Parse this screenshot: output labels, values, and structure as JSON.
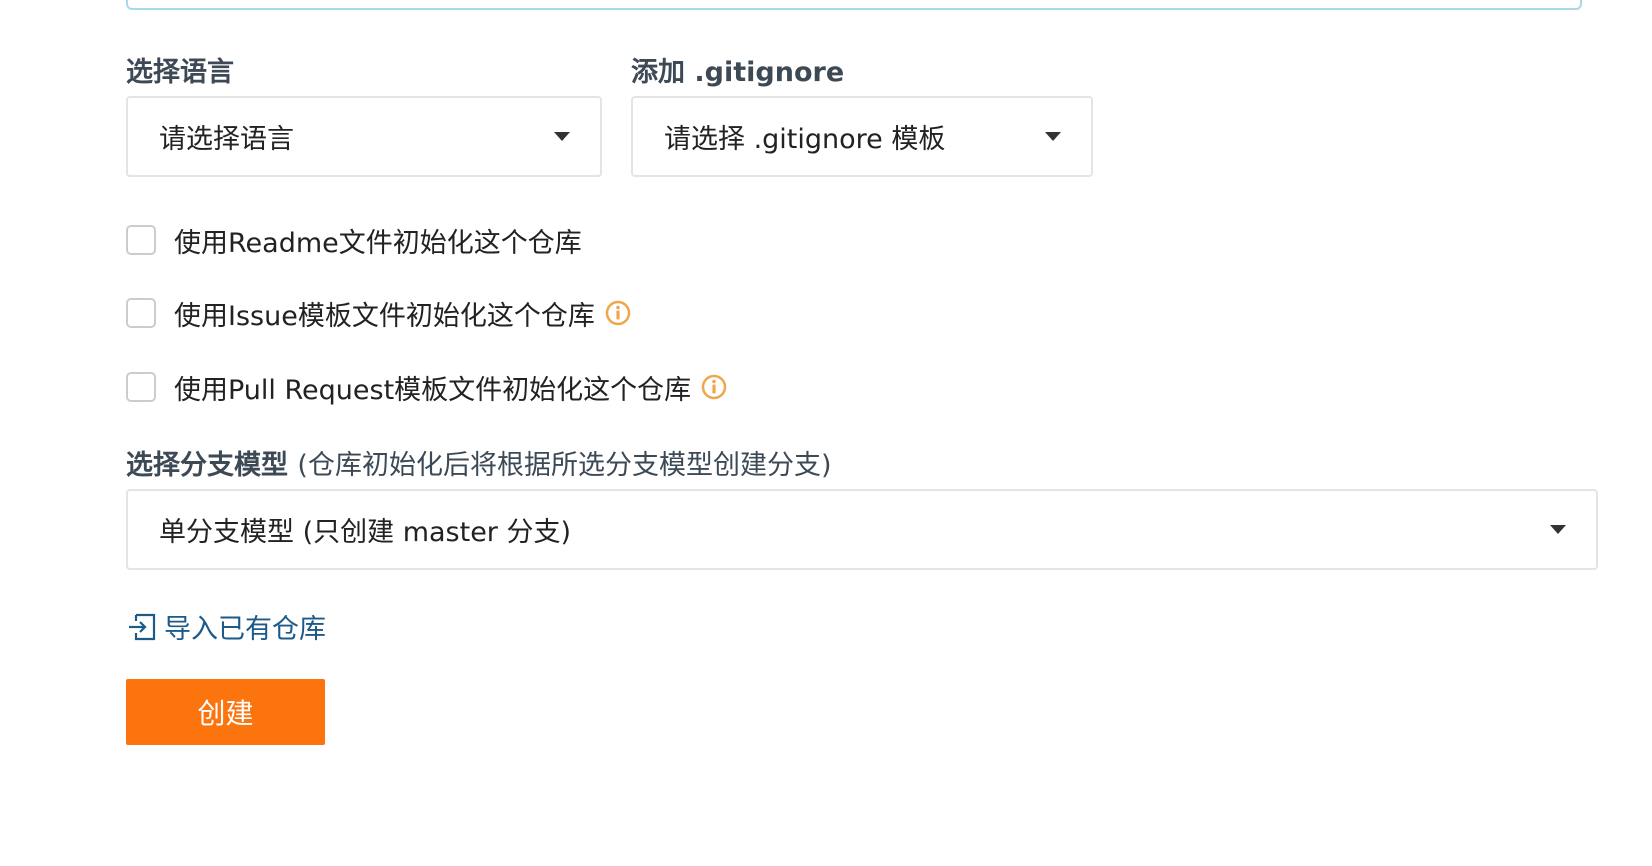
{
  "language": {
    "label": "选择语言",
    "selected": "请选择语言"
  },
  "gitignore": {
    "label": "添加 .gitignore",
    "selected": "请选择 .gitignore 模板"
  },
  "options": {
    "readme": "使用Readme文件初始化这个仓库",
    "issue": "使用Issue模板文件初始化这个仓库",
    "pull_request": "使用Pull Request模板文件初始化这个仓库"
  },
  "branch_model": {
    "label": "选择分支模型",
    "hint": "(仓库初始化后将根据所选分支模型创建分支)",
    "selected": "单分支模型 (只创建 master 分支)"
  },
  "import_link": "导入已有仓库",
  "create_button": "创建",
  "colors": {
    "accent_orange": "#fb740d",
    "info_icon": "#f0a64a",
    "link_blue": "#1c5a8a"
  },
  "icons": {
    "info": "info-circle-icon",
    "import": "import-icon",
    "caret": "caret-down-icon"
  }
}
